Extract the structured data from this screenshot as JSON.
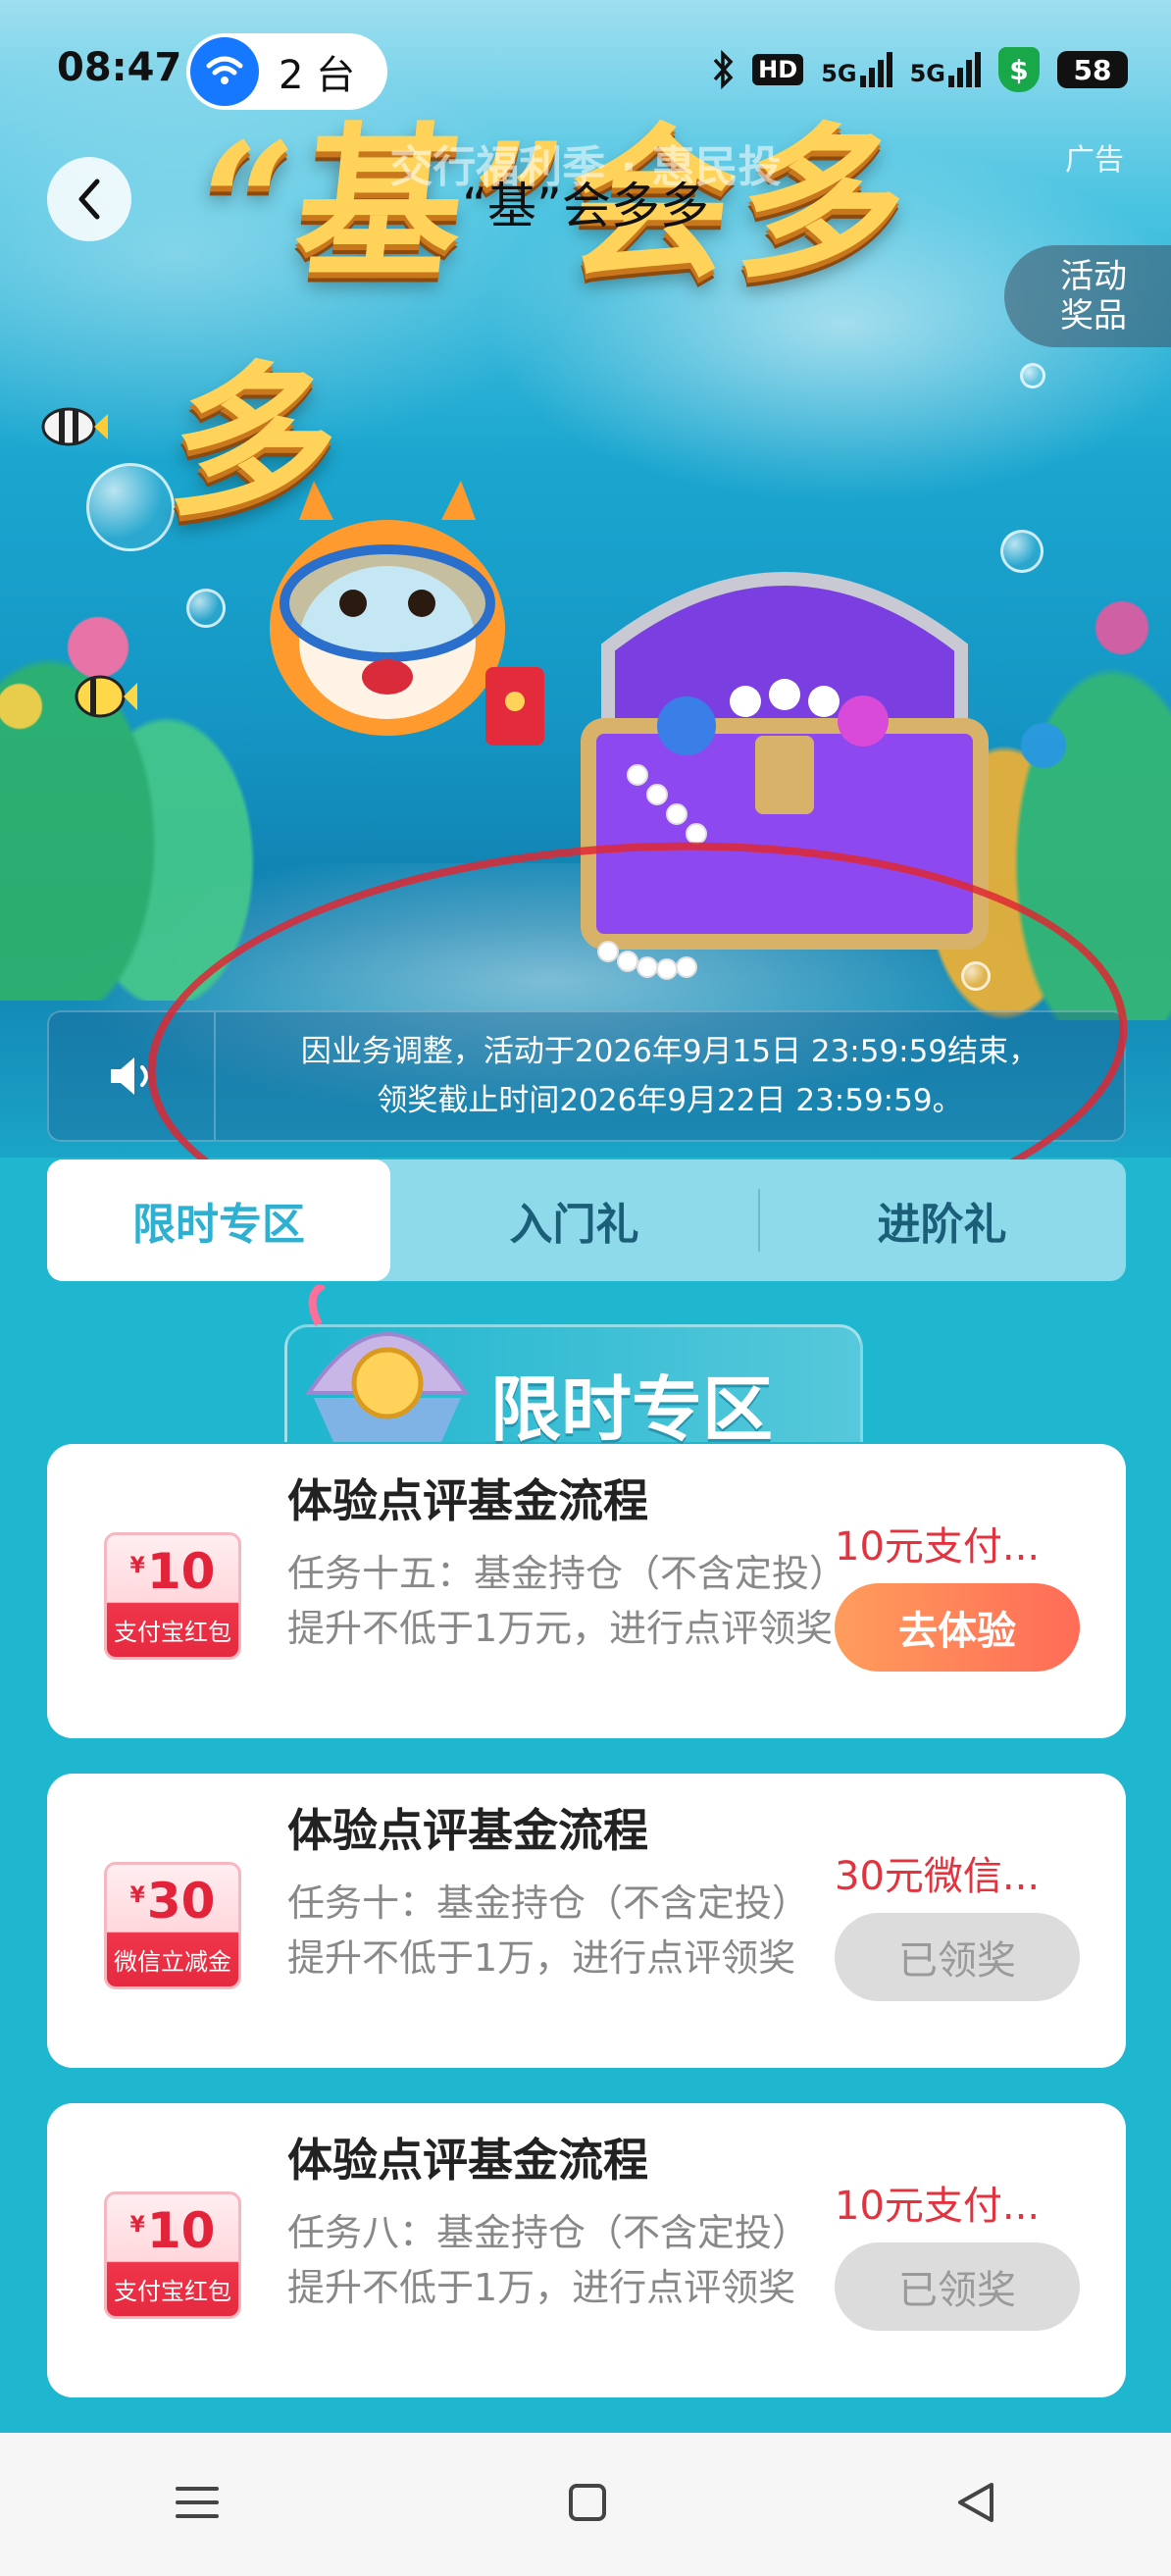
{
  "status_bar": {
    "time": "08:47",
    "hotspot_count": "2 台",
    "signal_1": "HD",
    "signal_2": "5G",
    "signal_3": "5G",
    "battery": "58"
  },
  "nav": {
    "title": "“基”会多多",
    "faded_title": "交行福利季 · 惠民投",
    "ad_label": "广告"
  },
  "hero": {
    "title_art": "“基”会多多",
    "prize_button": [
      "活动",
      "奖品"
    ]
  },
  "notice": {
    "line1": "因业务调整，活动于2026年9月15日 23:59:59结束，",
    "line2": "领奖截止时间2026年9月22日 23:59:59。"
  },
  "tabs": [
    {
      "label": "限时专区",
      "active": true
    },
    {
      "label": "入门礼",
      "active": false
    },
    {
      "label": "进阶礼",
      "active": false
    }
  ],
  "section": {
    "title": "限时专区"
  },
  "tasks": [
    {
      "coupon_amount": "10",
      "coupon_currency": "¥",
      "coupon_type": "支付宝红包",
      "title": "体验点评基金流程",
      "desc": "任务十五：基金持仓（不含定投）提升不低于1万元，进行点评领奖",
      "reward": "10元支付...",
      "button": "去体验",
      "button_state": "active"
    },
    {
      "coupon_amount": "30",
      "coupon_currency": "¥",
      "coupon_type": "微信立减金",
      "title": "体验点评基金流程",
      "desc": "任务十：基金持仓（不含定投）提升不低于1万，进行点评领奖",
      "reward": "30元微信...",
      "button": "已领奖",
      "button_state": "done"
    },
    {
      "coupon_amount": "10",
      "coupon_currency": "¥",
      "coupon_type": "支付宝红包",
      "title": "体验点评基金流程",
      "desc": "任务八：基金持仓（不含定投）提升不低于1万，进行点评领奖",
      "reward": "10元支付...",
      "button": "已领奖",
      "button_state": "done"
    }
  ],
  "colors": {
    "accent": "#2fb0d0",
    "reward_red": "#e2333f",
    "go_button": "#ff7a57",
    "annotation_circle": "#de2832"
  }
}
